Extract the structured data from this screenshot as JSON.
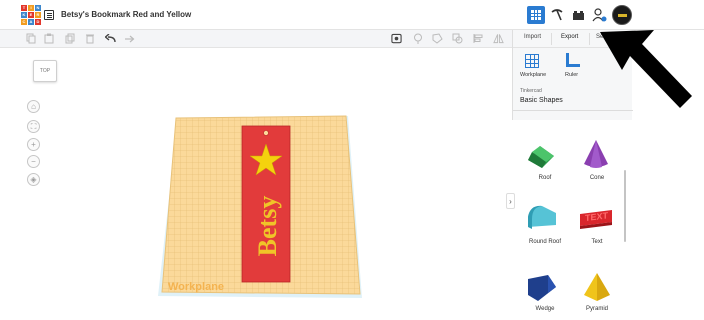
{
  "app": {
    "logo_letters": [
      "T",
      "I",
      "N",
      "K",
      "E",
      "R",
      "C",
      "A",
      "D"
    ],
    "project_title": "Betsy's Bookmark Red and Yellow"
  },
  "header": {
    "right_icons": [
      "grid-view-icon",
      "pickaxe-icon",
      "bricks-icon",
      "user-add-icon",
      "user-avatar"
    ]
  },
  "toolbar": {
    "left_tools": [
      "copy-icon",
      "paste-icon",
      "duplicate-icon",
      "delete-icon",
      "undo-icon",
      "redo-icon"
    ],
    "right_tools": [
      "note-icon",
      "light-bulb-icon",
      "shape-outline-icon",
      "group-icon",
      "align-icon",
      "mirror-icon"
    ]
  },
  "panel": {
    "tabs": [
      "Import",
      "Export",
      "Send To"
    ],
    "tools": [
      {
        "label": "Workplane",
        "icon": "workplane-icon"
      },
      {
        "label": "Ruler",
        "icon": "ruler-icon"
      }
    ],
    "library_brand": "Tinkercad",
    "library_name": "Basic Shapes",
    "shapes": [
      {
        "label": "Roof",
        "color": "#2e9e4f"
      },
      {
        "label": "Cone",
        "color": "#8a3fb0"
      },
      {
        "label": "Round Roof",
        "color": "#56c3d6"
      },
      {
        "label": "Text",
        "color": "#d9262c"
      },
      {
        "label": "Wedge",
        "color": "#1f3f8c"
      },
      {
        "label": "Pyramid",
        "color": "#f0c41b"
      }
    ]
  },
  "viewcube": {
    "label": "TOP"
  },
  "view_controls": [
    "home-view-icon",
    "fit-view-icon",
    "zoom-in-icon",
    "zoom-out-icon",
    "perspective-icon"
  ],
  "canvas": {
    "workplane_label": "Workplane",
    "bookmark_text": "Betsy",
    "bookmark_color": "#e23b3b",
    "star_color": "#f4d20e",
    "text_color": "#f0c428"
  }
}
